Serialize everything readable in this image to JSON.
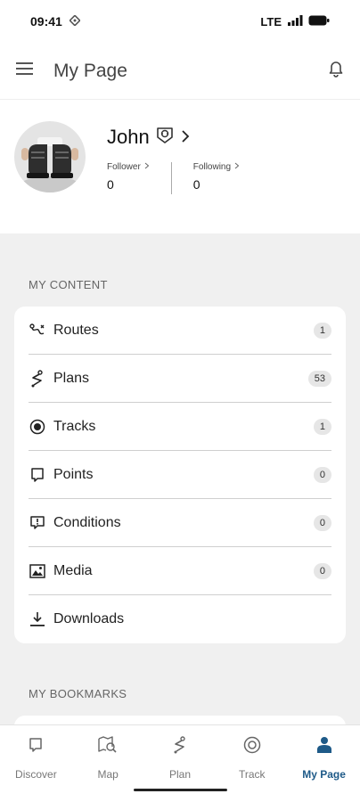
{
  "status_bar": {
    "time": "09:41",
    "network": "LTE"
  },
  "header": {
    "title": "My Page"
  },
  "profile": {
    "name": "John",
    "follower_label": "Follower",
    "follower_count": "0",
    "following_label": "Following",
    "following_count": "0"
  },
  "content_section": {
    "title": "MY CONTENT",
    "items": [
      {
        "label": "Routes",
        "count": "1",
        "icon": "routes-icon"
      },
      {
        "label": "Plans",
        "count": "53",
        "icon": "plans-icon"
      },
      {
        "label": "Tracks",
        "count": "1",
        "icon": "tracks-icon"
      },
      {
        "label": "Points",
        "count": "0",
        "icon": "points-icon"
      },
      {
        "label": "Conditions",
        "count": "0",
        "icon": "conditions-icon"
      },
      {
        "label": "Media",
        "count": "0",
        "icon": "media-icon"
      },
      {
        "label": "Downloads",
        "icon": "download-icon"
      }
    ]
  },
  "bookmarks_section": {
    "title": "MY BOOKMARKS"
  },
  "bottom_nav": {
    "items": [
      {
        "label": "Discover",
        "icon": "discover-icon"
      },
      {
        "label": "Map",
        "icon": "map-icon"
      },
      {
        "label": "Plan",
        "icon": "plan-icon"
      },
      {
        "label": "Track",
        "icon": "track-icon"
      },
      {
        "label": "My Page",
        "icon": "person-icon"
      }
    ],
    "active": "My Page"
  },
  "colors": {
    "accent": "#1e5a88",
    "background": "#f0f0f0"
  }
}
